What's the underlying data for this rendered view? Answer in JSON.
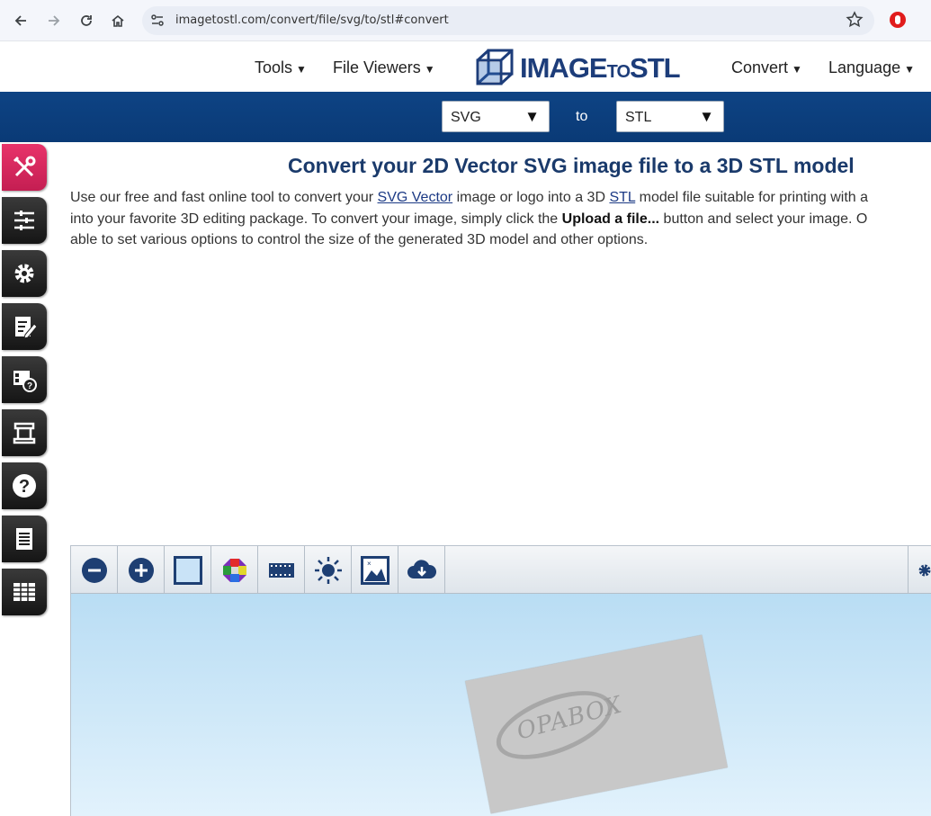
{
  "browser": {
    "url": "imagetostl.com/convert/file/svg/to/stl#convert"
  },
  "header": {
    "nav": [
      {
        "label": "Tools"
      },
      {
        "label": "File Viewers"
      },
      {
        "label": "Convert"
      },
      {
        "label": "Language"
      }
    ],
    "logo": {
      "main": "IMAGE",
      "small": "TO",
      "end": "STL"
    }
  },
  "converter": {
    "from": "SVG",
    "to_label": "to",
    "to": "STL"
  },
  "sidebar": {
    "icons": [
      "tools-icon",
      "options-list-icon",
      "settings-gear-icon",
      "edit-document-icon",
      "help-search-icon",
      "printer-icon",
      "question-icon",
      "document-list-icon",
      "table-grid-icon"
    ]
  },
  "main": {
    "title": "Convert your 2D Vector SVG image file to a 3D STL model",
    "intro": {
      "line1_a": "Use our free and fast online tool to convert your ",
      "link_svg": "SVG Vector",
      "line1_b": " image or logo into a 3D ",
      "link_stl": "STL",
      "line1_c": " model file suitable for printing with a",
      "line2_a": "into your favorite 3D editing package. To convert your image, simply click the ",
      "line2_bold": "Upload a file...",
      "line2_b": " button and select your image. O",
      "line3": "able to set various options to control the size of the generated 3D model and other options."
    }
  },
  "viewer": {
    "toolbar": [
      "zoom-out-icon",
      "zoom-in-icon",
      "frame-icon",
      "colors-icon",
      "film-strip-icon",
      "brightness-icon",
      "background-image-icon",
      "download-cloud-icon",
      "settings-gear-icon"
    ],
    "model_text": "OPABOX"
  },
  "colors": {
    "brand_blue": "#0e4384",
    "title_blue": "#1a3a6b",
    "active_tool": "#d82a5f"
  }
}
